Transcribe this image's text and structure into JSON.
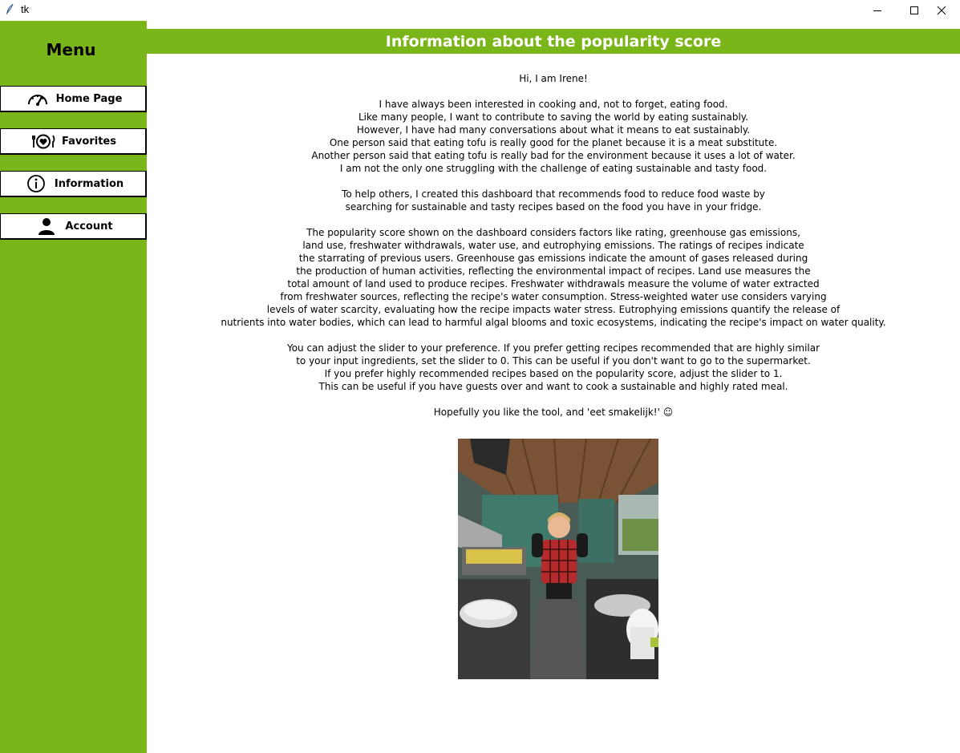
{
  "window": {
    "title": "tk"
  },
  "sidebar": {
    "menu_title": "Menu",
    "items": [
      {
        "label": "Home Page",
        "icon": "speedometer-icon"
      },
      {
        "label": "Favorites",
        "icon": "plate-heart-icon"
      },
      {
        "label": "Information",
        "icon": "info-icon"
      },
      {
        "label": "Account",
        "icon": "user-icon"
      }
    ]
  },
  "header": {
    "title": "Information about the popularity score"
  },
  "content": {
    "greeting": "Hi, I am Irene!",
    "p1": [
      "I have always been interested in cooking and, not to forget, eating food.",
      "Like many people, I want to contribute to saving the world by eating sustainably.",
      "However, I have had many conversations about what it means to eat sustainably.",
      "One person said that eating tofu is really good for the planet because it is a meat substitute.",
      "Another person said that eating tofu is really bad for the environment because it uses a lot of water.",
      "I am not the only one struggling with the challenge of eating sustainable and tasty food."
    ],
    "p2": [
      "To help others, I created this dashboard that recommends food to reduce food waste by",
      "searching for sustainable and tasty recipes based on the food you have in your fridge."
    ],
    "p3": [
      "The popularity score shown on the dashboard considers factors like rating, greenhouse gas emissions,",
      "land use, freshwater withdrawals, water use, and eutrophying emissions. The ratings of recipes indicate",
      "the starrating of previous users. Greenhouse gas emissions indicate the amount of gases released during",
      "the production of human activities, reflecting the environmental impact of recipes. Land use measures the",
      "total amount of land used to produce recipes. Freshwater withdrawals measure the volume of water extracted",
      "from freshwater sources, reflecting the recipe's water consumption. Stress-weighted water use considers varying",
      "levels of water scarcity, evaluating how the recipe impacts water stress. Eutrophying emissions quantify the release of",
      "nutrients into water bodies, which can lead to harmful algal blooms and toxic ecosystems, indicating the recipe's impact on water quality."
    ],
    "p4": [
      "You can adjust the slider to your preference. If you prefer getting recipes recommended that are highly similar",
      "to your input ingredients, set the slider to 0. This can be useful if you don't want to go to the supermarket.",
      "If you prefer highly recommended recipes based on the popularity score, adjust the slider to 1.",
      "This can be useful if you have guests over and want to cook a sustainable and highly rated meal."
    ],
    "closing": "Hopefully you like the tool, and 'eet smakelijk!' ☺"
  },
  "colors": {
    "accent_green": "#7ab51a",
    "header_text": "#ffffff"
  }
}
